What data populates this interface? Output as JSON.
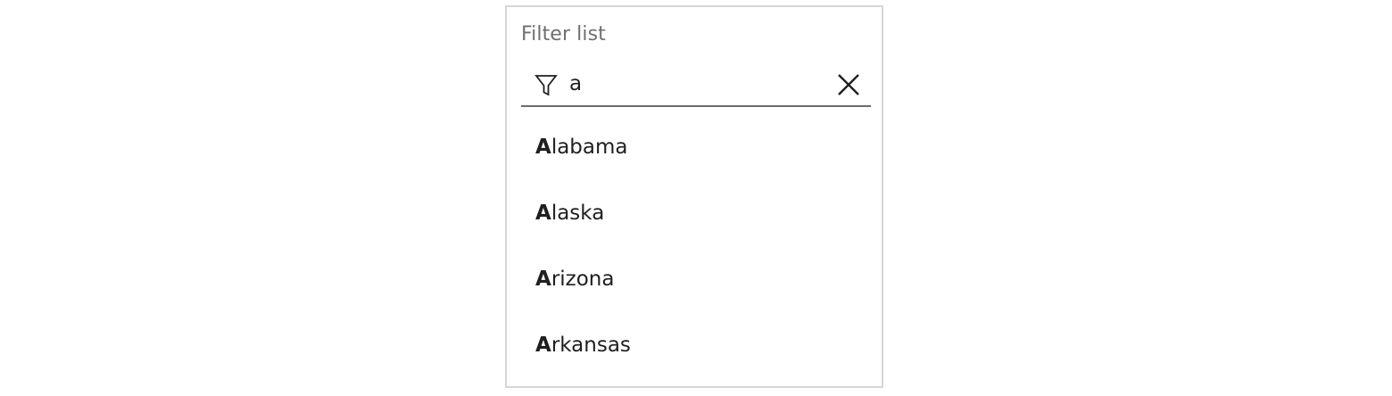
{
  "filter": {
    "label": "Filter list",
    "value": "a",
    "placeholder": ""
  },
  "icons": {
    "filter": "filter-funnel-icon",
    "clear": "close-x-icon"
  },
  "options": [
    {
      "match": "A",
      "rest": "labama"
    },
    {
      "match": "A",
      "rest": "laska"
    },
    {
      "match": "A",
      "rest": "rizona"
    },
    {
      "match": "A",
      "rest": "rkansas"
    }
  ],
  "colors": {
    "border": "#d6d6d6",
    "underline": "#6b6b6b",
    "label": "#6f6f6f",
    "text": "#1f1f1f"
  }
}
